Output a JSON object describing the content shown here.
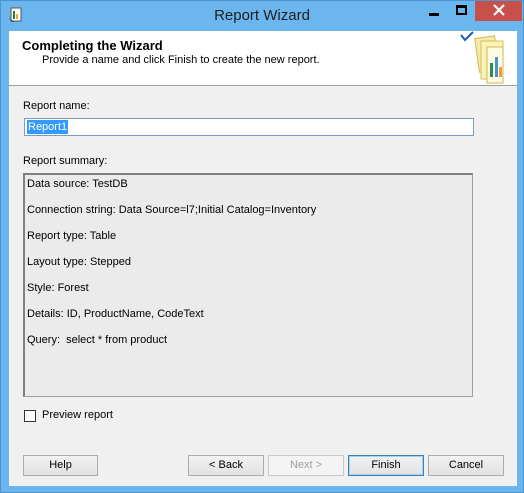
{
  "window": {
    "title": "Report Wizard",
    "icons": {
      "app": "report-wizard-icon",
      "minimize": "minimize-icon",
      "maximize": "maximize-icon",
      "close": "close-icon"
    },
    "colors": {
      "titlebar": "#6cb6f0",
      "close": "#c7504a"
    }
  },
  "header": {
    "title": "Completing the Wizard",
    "subtitle": "Provide a name and click Finish to create the new report.",
    "graphic": "report-documents-graphic"
  },
  "form": {
    "report_name_label": "Report name:",
    "report_name_value": "Report1",
    "summary_label": "Report summary:",
    "summary_lines": [
      "Data source: TestDB",
      "Connection string: Data Source=l7;Initial Catalog=Inventory",
      "Report type: Table",
      "Layout type: Stepped",
      "Style: Forest",
      "Details: ID, ProductName, CodeText",
      "Query:  select * from product"
    ],
    "preview_label": "Preview report",
    "preview_checked": false
  },
  "buttons": {
    "help": "Help",
    "back": "< Back",
    "next": "Next >",
    "finish": "Finish",
    "cancel": "Cancel"
  }
}
